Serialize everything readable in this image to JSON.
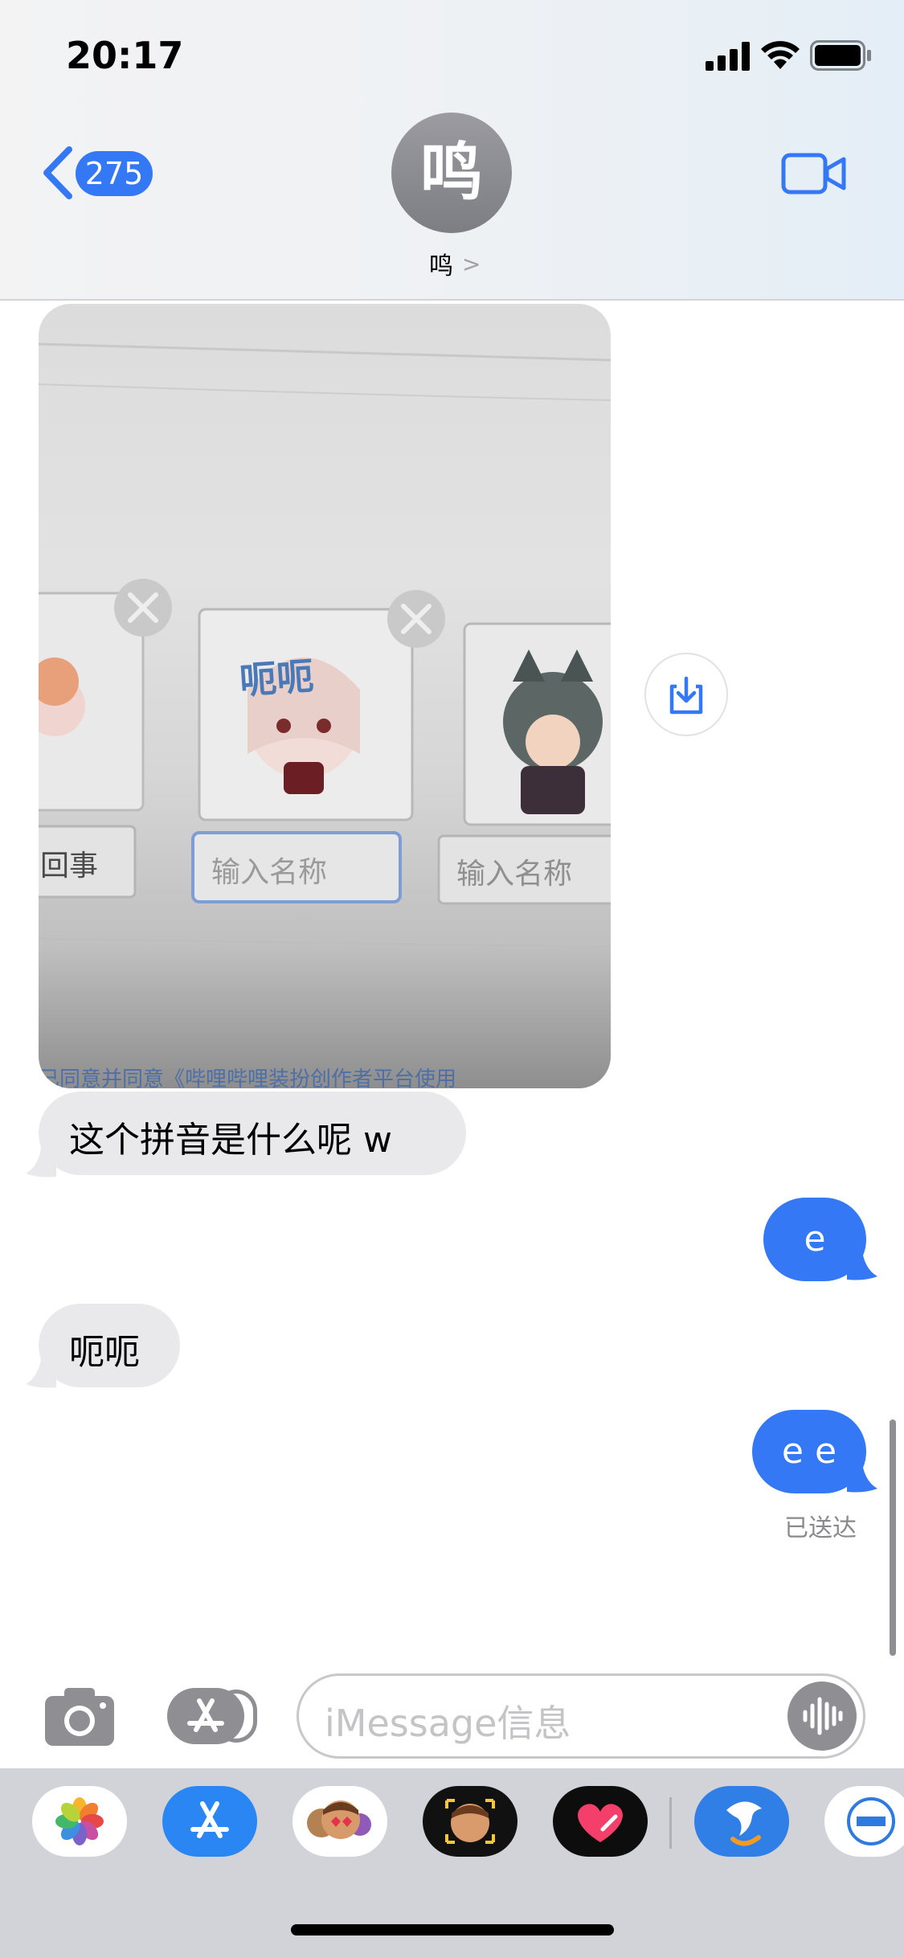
{
  "status_bar": {
    "time": "20:17"
  },
  "nav": {
    "unread_count": "275",
    "avatar_initial": "鸣",
    "contact_name": "鸣",
    "chevron": ">"
  },
  "photo": {
    "labels": [
      "回事",
      "输入名称",
      "输入名称"
    ],
    "sticker_text": "呃呃",
    "footer_text": "已同意并同意《哔哩哔哩装扮创作者平台使用"
  },
  "messages": [
    {
      "direction": "in",
      "text": "这个拼音是什么呢 w"
    },
    {
      "direction": "out",
      "text": "e"
    },
    {
      "direction": "in",
      "text": "呃呃"
    },
    {
      "direction": "out",
      "text": "e e"
    }
  ],
  "delivered_status": "已送达",
  "composer": {
    "placeholder": "iMessage信息"
  },
  "colors": {
    "accent": "#3478f6",
    "incoming_bubble": "#e9e9eb",
    "icon_gray": "#8e8e93"
  }
}
